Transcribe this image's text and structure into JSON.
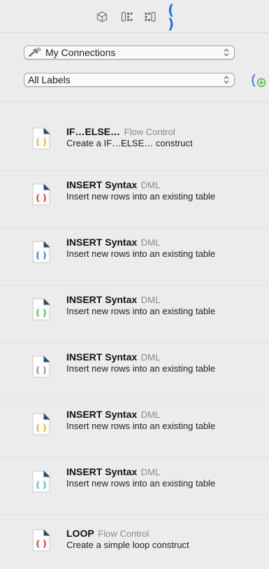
{
  "toolbar": {
    "icons": [
      "cube-icon",
      "grid-icon",
      "grid-icon",
      "parentheses-icon"
    ],
    "active_color": "#2a6fe8"
  },
  "connections": {
    "label": "My Connections"
  },
  "labels": {
    "label": "All Labels"
  },
  "snippets": [
    {
      "name": "IF…ELSE…",
      "category": "Flow Control",
      "description": "Create a IF…ELSE… construct",
      "color": "#f0a81c"
    },
    {
      "name": "INSERT Syntax",
      "category": "DML",
      "description": "Insert new rows into an existing table",
      "color": "#e02828"
    },
    {
      "name": "INSERT Syntax",
      "category": "DML",
      "description": "Insert new rows into an existing table",
      "color": "#2a6fe8"
    },
    {
      "name": "INSERT Syntax",
      "category": "DML",
      "description": "Insert new rows into an existing table",
      "color": "#3cb83c"
    },
    {
      "name": "INSERT Syntax",
      "category": "DML",
      "description": "Insert new rows into an existing table",
      "color": "#8a8a8a"
    },
    {
      "name": "INSERT Syntax",
      "category": "DML",
      "description": "Insert new rows into an existing table",
      "color": "#f0a81c"
    },
    {
      "name": "INSERT Syntax",
      "category": "DML",
      "description": "Insert new rows into an existing table",
      "color": "#3cb6d8"
    },
    {
      "name": "LOOP",
      "category": "Flow Control",
      "description": "Create a simple loop construct",
      "color": "#e02828"
    }
  ]
}
